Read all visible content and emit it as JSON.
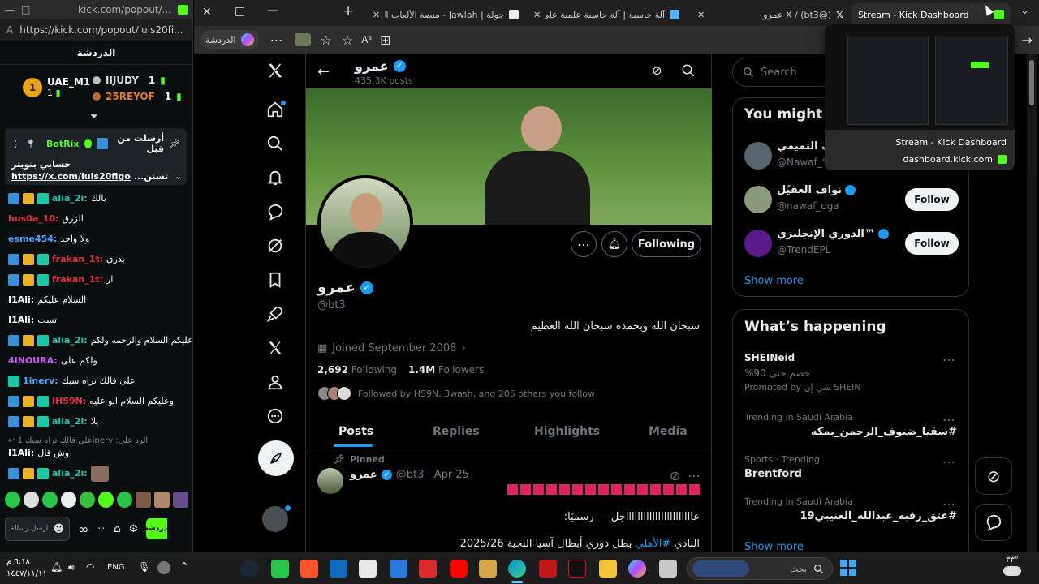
{
  "kick": {
    "tab_url": "kick.com/popout/...",
    "address": "https://kick.com/popout/luis20fi...",
    "title": "الدردشة",
    "leaderboard": {
      "first": {
        "rank": "1",
        "name": "UAE_M1",
        "count": "1"
      },
      "second": {
        "name": "IIJUDY",
        "count": "1"
      },
      "third": {
        "name": "25REYOF",
        "count": "1"
      }
    },
    "pinned": {
      "by_label": "أرسلت من قبل",
      "user": "BotRix",
      "line1": "حسابي بتويتر",
      "link": "https://x.com/luis20figo",
      "link_suffix": "...تسنن"
    },
    "messages": [
      {
        "user": "alia_2i:",
        "text": "بالك",
        "color": "#27c6a8",
        "badges": [
          "b1",
          "b2",
          "b3"
        ]
      },
      {
        "user": "hus0a_10:",
        "text": "الزرق",
        "color": "#e0333b",
        "badges": []
      },
      {
        "user": "esme454:",
        "text": "ولا واحد",
        "color": "#4fa3ff",
        "badges": []
      },
      {
        "user": "frakan_1t:",
        "text": "بدري",
        "color": "#e0333b",
        "badges": [
          "b1",
          "b2",
          "b3"
        ]
      },
      {
        "user": "frakan_1t:",
        "text": "ار",
        "color": "#e0333b",
        "badges": [
          "b1",
          "b2",
          "b3"
        ]
      },
      {
        "user": "I1Ali:",
        "text": "السلام عليكم",
        "color": "#ffffff",
        "badges": []
      },
      {
        "user": "I1Ali:",
        "text": "تست",
        "color": "#ffffff",
        "badges": []
      },
      {
        "user": "alia_2i:",
        "text": "وعليكم السلام والرحمه ولكم",
        "color": "#27c6a8",
        "badges": [
          "b1",
          "b2",
          "b3"
        ]
      },
      {
        "user": "4INOURA:",
        "text": "ولكم على",
        "color": "#c45cf0",
        "badges": []
      },
      {
        "user": "1inerv:",
        "text": "على فالك تراه سبك",
        "color": "#4fa3ff",
        "badges": [
          "b3"
        ]
      },
      {
        "user": "IH59N:",
        "text": "وعليكم السلام ابو عليه",
        "color": "#e0333b",
        "badges": [
          "b1",
          "b2",
          "b3"
        ]
      },
      {
        "user": "alia_2i:",
        "text": "يلا",
        "color": "#27c6a8",
        "badges": [
          "b1",
          "b2",
          "b3"
        ]
      }
    ],
    "reply_note": "على فالك تراه سبك 1inerv :الرد على",
    "reply_msg": {
      "user": "I1Ali:",
      "text": "وش قال",
      "color": "#ffffff"
    },
    "last_msg": {
      "user": "alia_2i:",
      "color": "#27c6a8"
    },
    "send_label": "دردشة",
    "input_placeholder": "ارسل رسالة"
  },
  "browser": {
    "tabs": [
      {
        "title": "جولة | Jawlah - منصة الألعاب التفاعلية"
      },
      {
        "title": "آلة حاسبة | آلة حاسبة علمية على الإنترنت"
      },
      {
        "title": "X / (bt3@) عمرو"
      },
      {
        "title": "Stream - Kick Dashboard"
      }
    ],
    "profile_label": "الدردشة"
  },
  "hover_preview": {
    "title": "Stream - Kick Dashboard",
    "url": "dashboard.kick.com"
  },
  "x": {
    "header_name": "عمرو",
    "header_posts": "435.3K posts",
    "following_label": "Following",
    "display_name": "عمرو",
    "handle": "@bt3",
    "bio": "سبحان الله وبحمده سبحان الله العظيم",
    "joined": "Joined September 2008",
    "following_count": "2,692",
    "following_word": "Following",
    "followers_count": "1.4M",
    "followers_word": "Followers",
    "followed_by": "Followed by HS9N, 3wash",
    "followed_by_more": ", and 205 others you follow",
    "tabs": [
      "Posts",
      "Replies",
      "Highlights",
      "Media"
    ],
    "pinned_label": "Pinned",
    "post": {
      "name": "عمرو",
      "meta": "@bt3 · Apr 25",
      "line2": "عاااااااااااااااااااااااجل — رسميًا:",
      "line3_pre": "النادي ",
      "line3_tag": "#الأهلي",
      "line3_post": " بطل دوري أبطال آسيا النخبة 2025/26"
    },
    "search_placeholder": "Search",
    "wtf_title": "You might like",
    "wtf": [
      {
        "name": "نواف التميمي",
        "handle": "@Nawaf_ST",
        "follow": "Follow"
      },
      {
        "name": "نواف العقيّل",
        "handle": "@nawaf_oga",
        "follow": "Follow"
      },
      {
        "name": "الدوري الإنجليزي™",
        "handle": "@TrendEPL",
        "follow": "Follow"
      }
    ],
    "show_more": "Show more",
    "happening_title": "What’s happening",
    "trends": [
      {
        "meta": "SHEINeid",
        "title": "خصم حتى 90%",
        "extra": "Promoted by شي إن SHEIN"
      },
      {
        "meta": "Trending in Saudi Arabia",
        "title": "#سقيا_ضيوف_الرحمن_بمكه",
        "extra": ""
      },
      {
        "meta": "Sports · Trending",
        "title": "Brentford",
        "extra": ""
      },
      {
        "meta": "Trending in Saudi Arabia",
        "title": "#عتق_رقبه_عبدالله_العنيبي19",
        "extra": ""
      }
    ],
    "show_more2": "Show more"
  },
  "taskbar": {
    "time": "٦:١٨ م",
    "date": "١٤٤٧/١١/١١",
    "lang": "ENG",
    "search_placeholder": "بحث",
    "temp": "٣٣°"
  },
  "colors": {
    "kick_green": "#53fc18",
    "x_blue": "#1d9bf0",
    "bg": "#000000"
  }
}
